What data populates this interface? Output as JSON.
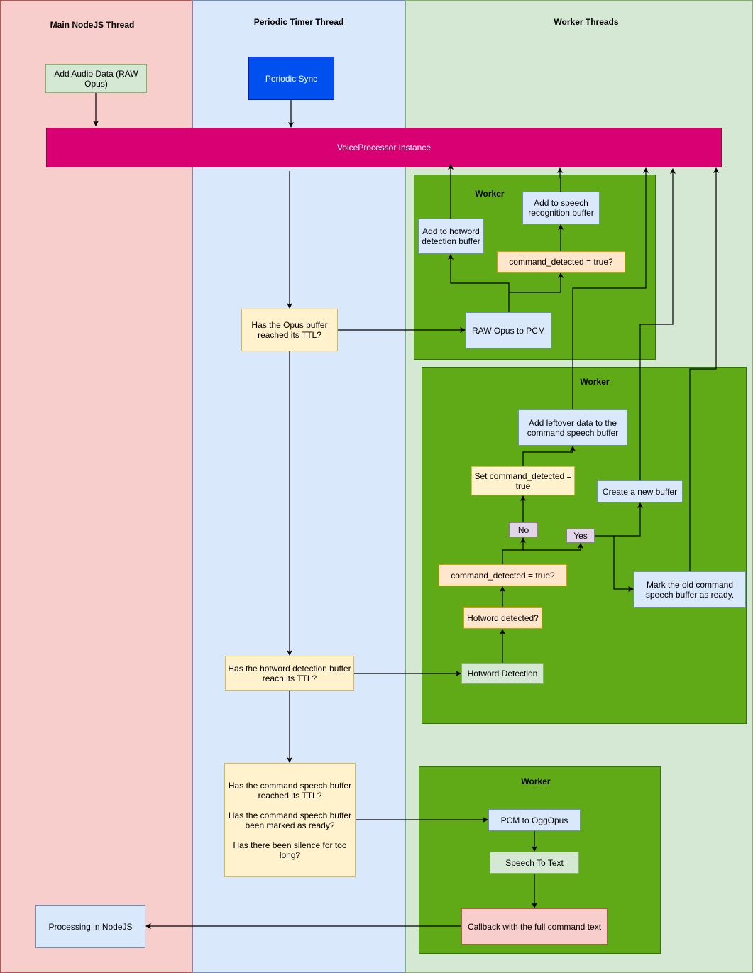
{
  "lanes": {
    "main": "Main NodeJS Thread",
    "timer": "Periodic Timer Thread",
    "workers": "Worker Threads"
  },
  "colors": {
    "main_lane": "#f8cecc",
    "timer_lane": "#dae8fc",
    "worker_lane": "#d5e8d4",
    "worker_box": "#60a917",
    "voice_processor": "#d80073",
    "periodic_sync": "#0050ef"
  },
  "nodes": {
    "add_audio": "Add Audio Data (RAW Opus)",
    "periodic_sync": "Periodic Sync",
    "voice_processor": "VoiceProcessor Instance",
    "opus_ttl": "Has the Opus buffer reached its TTL?",
    "hotword_ttl": "Has the hotword detection buffer reach its TTL?",
    "command_checks": "Has the command speech buffer reached its TTL?\n\nHas the command speech buffer been marked as ready?\n\nHas there been silence for too long?",
    "processing_nodejs": "Processing in NodeJS"
  },
  "worker1": {
    "title": "Worker",
    "add_hotword_buffer": "Add to hotword detection buffer",
    "add_speech_buffer": "Add to speech recognition buffer",
    "command_detected_check": "command_detected = true?",
    "opus_to_pcm": "RAW Opus to PCM"
  },
  "worker2": {
    "title": "Worker",
    "add_leftover": "Add leftover data to the command speech buffer",
    "set_command_detected": "Set command_detected = true",
    "create_buffer": "Create a new buffer",
    "no_label": "No",
    "yes_label": "Yes",
    "command_detected_check": "command_detected = true?",
    "hotword_detected": "Hotword detected?",
    "mark_ready": "Mark the old command speech buffer as ready.",
    "hotword_detection": "Hotword Detection"
  },
  "worker3": {
    "title": "Worker",
    "pcm_to_ogg": "PCM to OggOpus",
    "speech_to_text": "Speech To Text",
    "callback": "Callback with the full command text"
  }
}
